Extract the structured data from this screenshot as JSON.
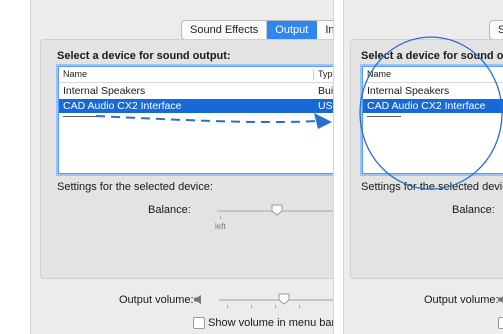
{
  "left": {
    "tabs": [
      {
        "label": "Sound Effects",
        "active": false
      },
      {
        "label": "Output",
        "active": true
      },
      {
        "label": "Inp",
        "active": false
      }
    ],
    "heading": "Select a device for sound output:",
    "columns": [
      "Name",
      "Type"
    ],
    "rows": [
      {
        "name": "Internal Speakers",
        "type": "Built-",
        "selected": false
      },
      {
        "name": "CAD Audio CX2 Interface",
        "type": "USB",
        "selected": true
      }
    ],
    "settings_label": "Settings for the selected device:",
    "balance_label": "Balance:",
    "balance_left": "left",
    "balance_level": 0.5,
    "volume_label": "Output volume:",
    "volume_level": 0.55,
    "menu_bar_label": "Show volume in menu bar",
    "menu_bar_checked": false
  },
  "right": {
    "tab_fragment": "S",
    "heading": "Select a device for sound outp",
    "columns": [
      "Name"
    ],
    "rows": [
      {
        "name": "Internal Speakers",
        "selected": false
      },
      {
        "name": "CAD Audio CX2 Interface",
        "selected": true
      }
    ],
    "settings_label": "Settings for the selected device",
    "balance_label": "Balance:",
    "volume_label": "Output volume:"
  },
  "colors": {
    "accent": "#2f86f0",
    "selection": "#1769d8",
    "annotation": "#2a6fc9"
  },
  "icons": {
    "speaker": "speaker-icon",
    "knob": "slider-knob-icon"
  }
}
